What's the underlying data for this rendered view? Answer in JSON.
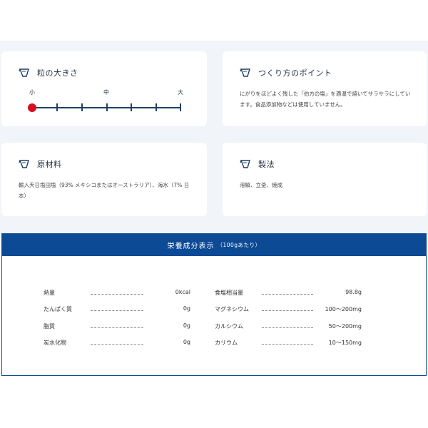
{
  "grain": {
    "title": "粒の大きさ",
    "labels": [
      "小",
      "中",
      "大"
    ]
  },
  "process": {
    "title": "つくり方のポイント",
    "body": "にがりをほどよく残した「伯方の塩」を適温で焼いてサラサラにしています。食品添加物などは使用していません。"
  },
  "ingredients": {
    "title": "原材料",
    "body": "輸入天日塩田塩（93% メキシコまたはオーストラリア）、海水（7% 日本）"
  },
  "method": {
    "title": "製法",
    "body": "溶解、立釜、焼成"
  },
  "nutrition": {
    "title": "栄養成分表示",
    "subtitle": "（100gあたり）",
    "left": [
      {
        "name": "熱量",
        "value": "0kcal"
      },
      {
        "name": "たんぱく質",
        "value": "0g"
      },
      {
        "name": "脂質",
        "value": "0g"
      },
      {
        "name": "炭水化物",
        "value": "0g"
      }
    ],
    "right": [
      {
        "name": "食塩相当量",
        "value": "98.8g"
      },
      {
        "name": "マグネシウム",
        "value": "100〜200mg"
      },
      {
        "name": "カルシウム",
        "value": "50〜200mg"
      },
      {
        "name": "カリウム",
        "value": "10〜150mg"
      }
    ]
  },
  "colors": {
    "accent": "#0c4a96",
    "marker": "#d60e1e",
    "panel": "#f1f4f8"
  }
}
